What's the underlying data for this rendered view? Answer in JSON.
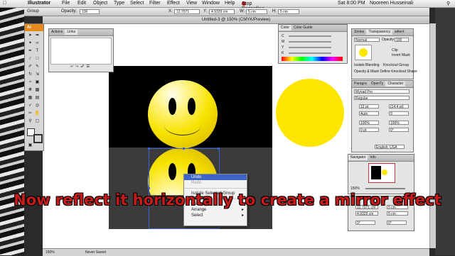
{
  "menubar": {
    "app": "Illustrator",
    "items": [
      "File",
      "Edit",
      "Object",
      "Type",
      "Select",
      "Filter",
      "Effect",
      "View",
      "Window",
      "Help"
    ],
    "record": "Stop Recording",
    "clock": "Sat 8:00 PM",
    "user": "Nooreen Husseinali"
  },
  "control": {
    "group_label": "Group",
    "opacity_label": "Opacity:",
    "opacity_value": "100",
    "x_label": "X:",
    "x_value": "12.7071",
    "y_label": "Y:",
    "y_value": "4.9329 cm",
    "w_label": "W:",
    "w_value": "5 cm",
    "h_label": "H:",
    "h_value": "5 cm"
  },
  "document": {
    "title": "Untitled-3 @ 150% (CMYK/Preview)"
  },
  "tools": {
    "header": "Ai"
  },
  "actions_panel": {
    "tabs": [
      "Actions",
      "Links"
    ]
  },
  "color_panel": {
    "tabs": [
      "Color",
      "Color Guide"
    ]
  },
  "transparency_panel": {
    "tabs": [
      "Stroke",
      "Transparency",
      "adient"
    ],
    "mode": "Normal",
    "opacity_label": "Opacity:",
    "opacity_value": "100",
    "clip": "Clip",
    "invert": "Invert Mask",
    "isolate": "Isolate Blending",
    "knockout": "Knockout Group",
    "opacity_mask": "Opacity & Mask Define Knockout Shape"
  },
  "character_panel": {
    "tabs": [
      "Paragra",
      "OpenTy",
      "Character"
    ],
    "font": "Myriad Pro",
    "style": "Regular",
    "size": "12 pt",
    "leading": "(14.4 pt)",
    "kern": "Auto",
    "track": "0",
    "hscale": "100%",
    "vscale": "100%",
    "baseline": "0 pt",
    "rotate": "0°",
    "lang": "English: USA"
  },
  "navigator": {
    "tabs": [
      "Navigator",
      "Info"
    ],
    "zoom": "150%"
  },
  "transform_panel": {
    "x": "12.7071 cm",
    "y": "4.9329 cm",
    "w": "5 cm",
    "h": "5 cm",
    "r": "0°",
    "s": "0°"
  },
  "context_menu": {
    "items": [
      {
        "label": "Undo",
        "state": "highlighted"
      },
      {
        "label": "Redo",
        "state": "disabled"
      },
      {
        "label": "Isolate Selected Group",
        "state": "normal"
      },
      {
        "label": "Transform",
        "state": "submenu"
      },
      {
        "label": "Arrange",
        "state": "submenu"
      },
      {
        "label": "Select",
        "state": "submenu"
      }
    ]
  },
  "status": {
    "zoom": "150%",
    "info": "Never Saved"
  },
  "caption": {
    "text": "Now reflect it horizontally to create a mirror effect"
  },
  "colors": {
    "accent": "#e68a1c",
    "selection": "#3a5fd9",
    "smiley": "#f7e300",
    "caption": "#c51b1b"
  }
}
